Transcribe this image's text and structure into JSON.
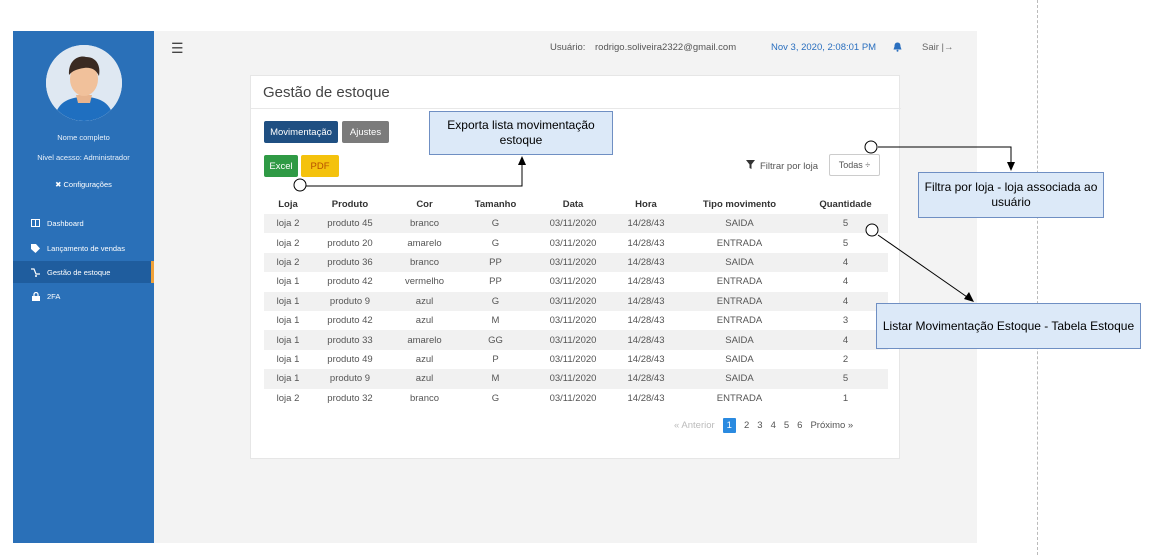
{
  "sidebar": {
    "user_name": "Nome completo",
    "access_level": "Nivel acesso: Administrador",
    "config": "Configurações",
    "items": [
      {
        "label": "Dashboard",
        "icon": "dashboard-icon"
      },
      {
        "label": "Lançamento de vendas",
        "icon": "tag-icon"
      },
      {
        "label": "Gestão de estoque",
        "icon": "stock-icon",
        "active": true
      },
      {
        "label": "2FA",
        "icon": "lock-icon"
      }
    ]
  },
  "topbar": {
    "user_label": "Usuário:",
    "user_email": "rodrigo.soliveira2322@gmail.com",
    "datetime": "Nov 3, 2020, 2:08:01 PM",
    "logout": "Sair |→"
  },
  "page": {
    "title": "Gestão de estoque",
    "tabs": {
      "movimentacao": "Movimentação",
      "ajustes": "Ajustes"
    },
    "export": {
      "excel": "Excel",
      "pdf": "PDF"
    },
    "filter_label": "Filtrar por loja",
    "filter_value": "Todas ÷"
  },
  "table": {
    "columns": [
      "Loja",
      "Produto",
      "Cor",
      "Tamanho",
      "Data",
      "Hora",
      "Tipo movimento",
      "Quantidade"
    ],
    "rows": [
      [
        "loja 2",
        "produto 45",
        "branco",
        "G",
        "03/11/2020",
        "14/28/43",
        "SAIDA",
        "5"
      ],
      [
        "loja 2",
        "produto 20",
        "amarelo",
        "G",
        "03/11/2020",
        "14/28/43",
        "ENTRADA",
        "5"
      ],
      [
        "loja 2",
        "produto 36",
        "branco",
        "PP",
        "03/11/2020",
        "14/28/43",
        "SAIDA",
        "4"
      ],
      [
        "loja 1",
        "produto 42",
        "vermelho",
        "PP",
        "03/11/2020",
        "14/28/43",
        "ENTRADA",
        "4"
      ],
      [
        "loja 1",
        "produto 9",
        "azul",
        "G",
        "03/11/2020",
        "14/28/43",
        "ENTRADA",
        "4"
      ],
      [
        "loja 1",
        "produto 42",
        "azul",
        "M",
        "03/11/2020",
        "14/28/43",
        "ENTRADA",
        "3"
      ],
      [
        "loja 1",
        "produto 33",
        "amarelo",
        "GG",
        "03/11/2020",
        "14/28/43",
        "SAIDA",
        "4"
      ],
      [
        "loja 1",
        "produto 49",
        "azul",
        "P",
        "03/11/2020",
        "14/28/43",
        "SAIDA",
        "2"
      ],
      [
        "loja 1",
        "produto 9",
        "azul",
        "M",
        "03/11/2020",
        "14/28/43",
        "SAIDA",
        "5"
      ],
      [
        "loja 2",
        "produto 32",
        "branco",
        "G",
        "03/11/2020",
        "14/28/43",
        "ENTRADA",
        "1"
      ]
    ]
  },
  "pagination": {
    "prev": "« Anterior",
    "pages": [
      "1",
      "2",
      "3",
      "4",
      "5",
      "6"
    ],
    "current": "1",
    "next": "Próximo »"
  },
  "annotations": {
    "export": "Exporta lista movimentação estoque",
    "filter": "Filtra por loja - loja associada ao usuário",
    "list": "Listar Movimentação Estoque - Tabela Estoque"
  },
  "colors": {
    "sidebar": "#2a70b8",
    "primary": "#1f4f82",
    "accent": "#2a8ae0",
    "note_bg": "#dce9f8"
  }
}
